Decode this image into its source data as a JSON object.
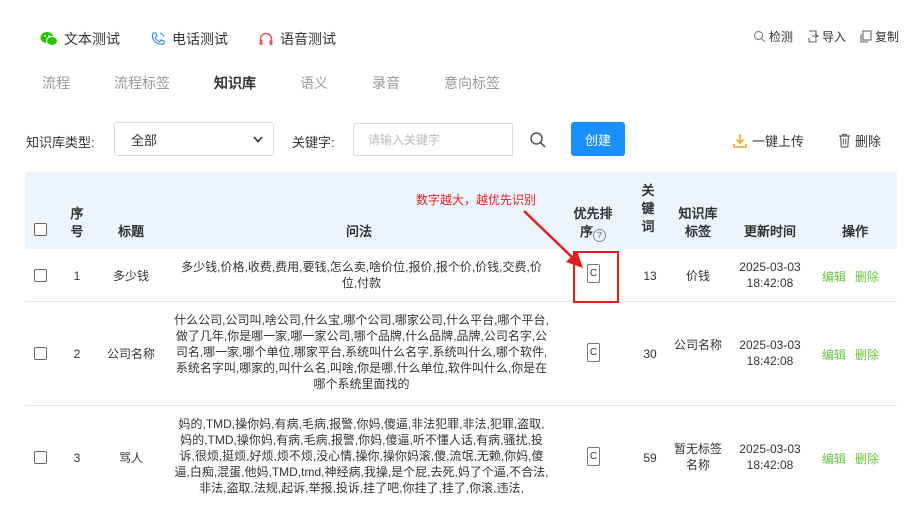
{
  "top_tabs": [
    {
      "label": "文本测试",
      "icon": "wechat-icon"
    },
    {
      "label": "电话测试",
      "icon": "phone-icon"
    },
    {
      "label": "语音测试",
      "icon": "headset-icon"
    }
  ],
  "top_actions": [
    {
      "label": "检测",
      "icon": "magnifier-icon"
    },
    {
      "label": "导入",
      "icon": "import-icon"
    },
    {
      "label": "复制",
      "icon": "copy-icon"
    }
  ],
  "sub_tabs": [
    "流程",
    "流程标签",
    "知识库",
    "语义",
    "录音",
    "意向标签"
  ],
  "active_sub_tab": "知识库",
  "filter": {
    "type_label": "知识库类型:",
    "type_value": "全部",
    "keyword_label": "关键字:",
    "keyword_placeholder": "请输入关键字",
    "create_label": "创建",
    "upload_label": "一键上传",
    "delete_label": "删除"
  },
  "annotation": "数字越大，越优先识别",
  "table": {
    "headers": {
      "index": "序号",
      "title": "标题",
      "question": "问法",
      "priority": "优先排序",
      "keywords": "关键词",
      "tag": "知识库标签",
      "updated": "更新时间",
      "ops": "操作"
    },
    "rows": [
      {
        "index": "1",
        "title": "多少钱",
        "question": "多少钱,价格,收费,费用,要钱,怎么卖,啥价位,报价,报个价,价钱,交费,价位,付款",
        "priority": "C",
        "keywords": "13",
        "tag": "价钱",
        "updated": "2025-03-03 18:42:08",
        "edit": "编辑",
        "delete": "删除"
      },
      {
        "index": "2",
        "title": "公司名称",
        "question": "什么公司,公司叫,啥公司,什么宝,哪个公司,哪家公司,什么平台,哪个平台,做了几年,你是哪一家,哪一家公司,哪个品牌,什么品牌,品牌,公司名字,公司名,哪一家,哪个单位,哪家平台,系统叫什么名字,系统叫什么,哪个软件,系统名字叫,哪家的,叫什么名,叫啥,你是哪,什么单位,软件叫什么,你是在哪个系统里面找的",
        "priority": "C",
        "keywords": "30",
        "tag": "公司名称",
        "updated": "2025-03-03 18:42:08",
        "edit": "编辑",
        "delete": "删除"
      },
      {
        "index": "3",
        "title": "骂人",
        "question": "妈的,TMD,操你妈,有病,毛病,报警,你妈,傻逼,非法犯罪,非法,犯罪,盗取,妈的,TMD,操你妈,有病,毛病,报警,你妈,傻逼,听不懂人话,有病,骚扰,投诉,很烦,挺烦,好烦,烦不烦,没心情,操你,操你妈滚,傻,流氓,无赖,你妈,傻逼,白痴,混蛋,他妈,TMD,tmd,神经病,我操,是个屁,去死,妈了个逼,不合法,非法,盗取,法规,起诉,举报,投诉,挂了吧,你挂了,挂了,你滚,违法,",
        "priority": "C",
        "keywords": "59",
        "tag": "暂无标签名称",
        "updated": "2025-03-03 18:42:08",
        "edit": "编辑",
        "delete": "删除"
      }
    ]
  },
  "colors": {
    "primary": "#1890ff",
    "link_green": "#67c23a",
    "annotation_red": "#e02020",
    "header_bg": "#eef4fc"
  }
}
